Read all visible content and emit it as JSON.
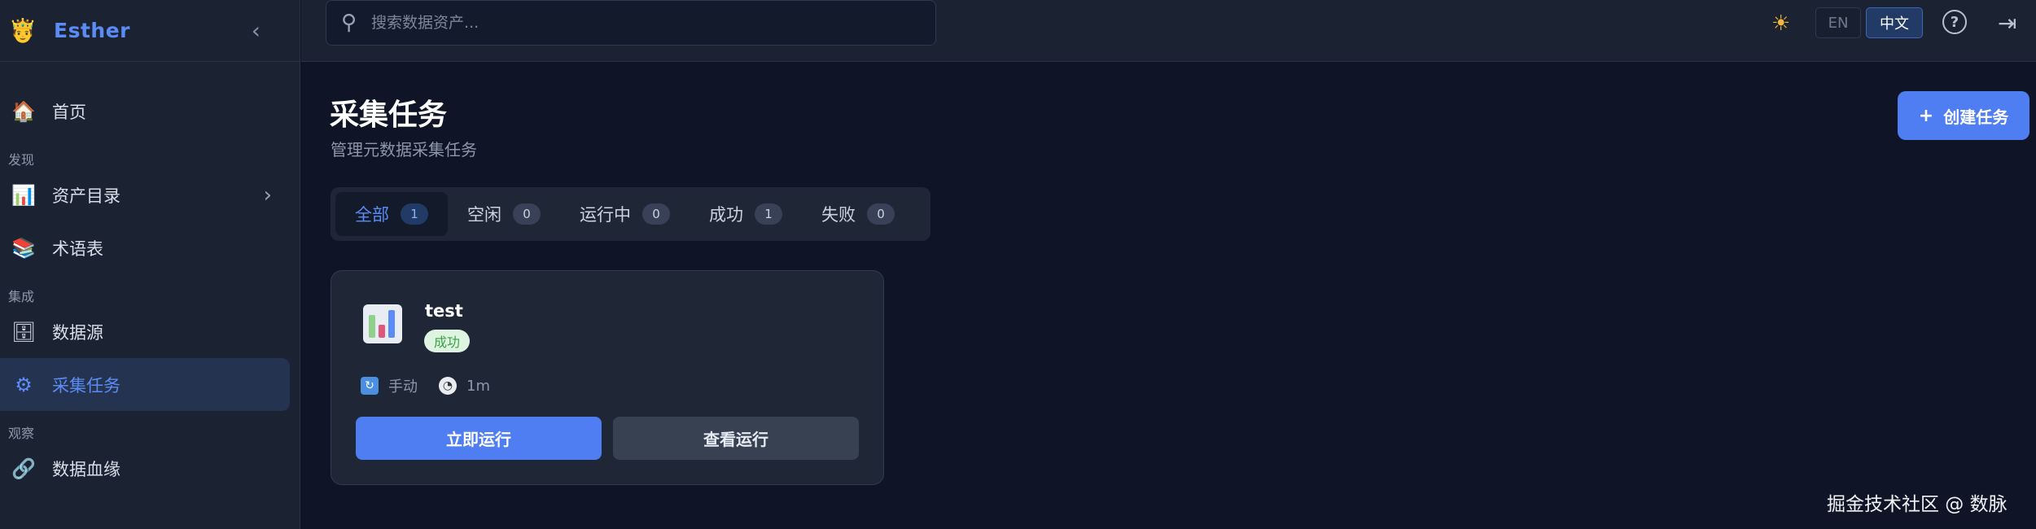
{
  "brand": {
    "name": "Esther"
  },
  "sidebar": {
    "items": [
      {
        "label": "首页",
        "icon": "house-icon"
      },
      {
        "section": "发现"
      },
      {
        "label": "资产目录",
        "icon": "bar-chart-icon",
        "has_arrow": true
      },
      {
        "label": "术语表",
        "icon": "books-icon"
      },
      {
        "section": "集成"
      },
      {
        "label": "数据源",
        "icon": "file-cabinet-icon"
      },
      {
        "label": "采集任务",
        "icon": "gear-icon",
        "active": true
      },
      {
        "section": "观察"
      },
      {
        "label": "数据血缘",
        "icon": "link-icon"
      }
    ],
    "sections": {
      "discover": "发现",
      "integrate": "集成",
      "observe": "观察"
    },
    "labels": {
      "home": "首页",
      "catalog": "资产目录",
      "glossary": "术语表",
      "datasource": "数据源",
      "ingestion": "采集任务",
      "lineage": "数据血缘"
    }
  },
  "topbar": {
    "search_placeholder": "搜索数据资产...",
    "lang_en": "EN",
    "lang_zh": "中文",
    "active_lang": "中文"
  },
  "main": {
    "title": "采集任务",
    "subtitle": "管理元数据采集任务",
    "create_label": "创建任务",
    "tabs": [
      {
        "label": "全部",
        "count": "1",
        "active": true
      },
      {
        "label": "空闲",
        "count": "0"
      },
      {
        "label": "运行中",
        "count": "0"
      },
      {
        "label": "成功",
        "count": "1"
      },
      {
        "label": "失败",
        "count": "0"
      }
    ],
    "card": {
      "name": "test",
      "status": "成功",
      "trigger": "手动",
      "interval": "1m",
      "run_label": "立即运行",
      "view_label": "查看运行"
    }
  },
  "watermark": "掘金技术社区 @ 数脉",
  "colors": {
    "accent": "#4f7ef2",
    "active_text": "#5b8cf6",
    "success_bg": "#dff3e1",
    "success_text": "#3aa246"
  }
}
